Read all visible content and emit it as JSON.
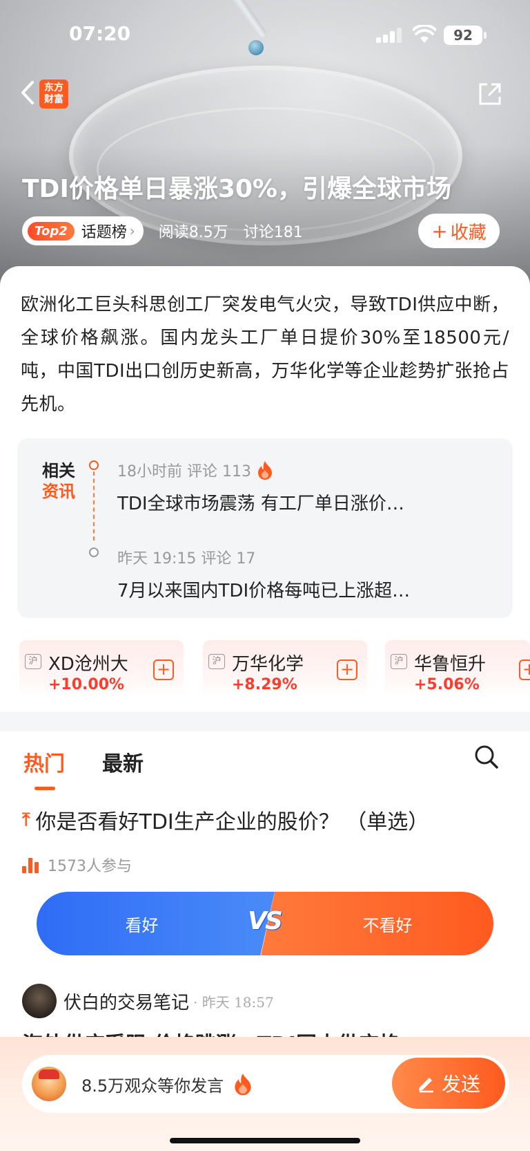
{
  "status_bar": {
    "time": "07:20",
    "battery": "92"
  },
  "header": {
    "logo_line1": "东方",
    "logo_line2": "财富",
    "title": "TDI价格单日暴涨30%，引爆全球市场",
    "rank_badge": "Top2",
    "topic_label": "话题榜",
    "reads": "阅读8.5万",
    "discussions": "讨论181",
    "favorite_label": "收藏"
  },
  "summary": {
    "text": "欧洲化工巨头科思创工厂突发电气火灾，导致TDI供应中断，全球价格飙涨。国内龙头工厂单日提价30%至18500元/吨，中国TDI出口创历史新高，万华化学等企业趁势扩张抢占先机。"
  },
  "related": {
    "label_line1": "相关",
    "label_line2": "资讯",
    "items": [
      {
        "meta": "18小时前  评论 113",
        "title": "TDI全球市场震荡 有工厂单日涨价…"
      },
      {
        "meta": "昨天 19:15  评论 17",
        "title": "7月以来国内TDI价格每吨已上涨超…"
      }
    ]
  },
  "stocks": [
    {
      "market": "沪",
      "name": "XD沧州大",
      "change": "+10.00%"
    },
    {
      "market": "沪",
      "name": "万华化学",
      "change": "+8.29%"
    },
    {
      "market": "沪",
      "name": "华鲁恒升",
      "change": "+5.06%"
    }
  ],
  "tabs": {
    "hot": "热门",
    "latest": "最新"
  },
  "poll": {
    "question": "你是否看好TDI生产企业的股价？ （单选）",
    "participants": "1573人参与",
    "option_yes": "看好",
    "option_no": "不看好",
    "vs": "VS"
  },
  "post": {
    "author": "伏白的交易笔记",
    "time": "· 昨天 18:57",
    "title_partial": "海外供应受阻 价格跳涨，TDI国内供应格"
  },
  "bottom": {
    "placeholder": "8.5万观众等你发言",
    "send_label": "发送"
  },
  "colors": {
    "accent": "#ff5a1f",
    "blue": "#2f6cf6",
    "up": "#ff3b2b"
  }
}
